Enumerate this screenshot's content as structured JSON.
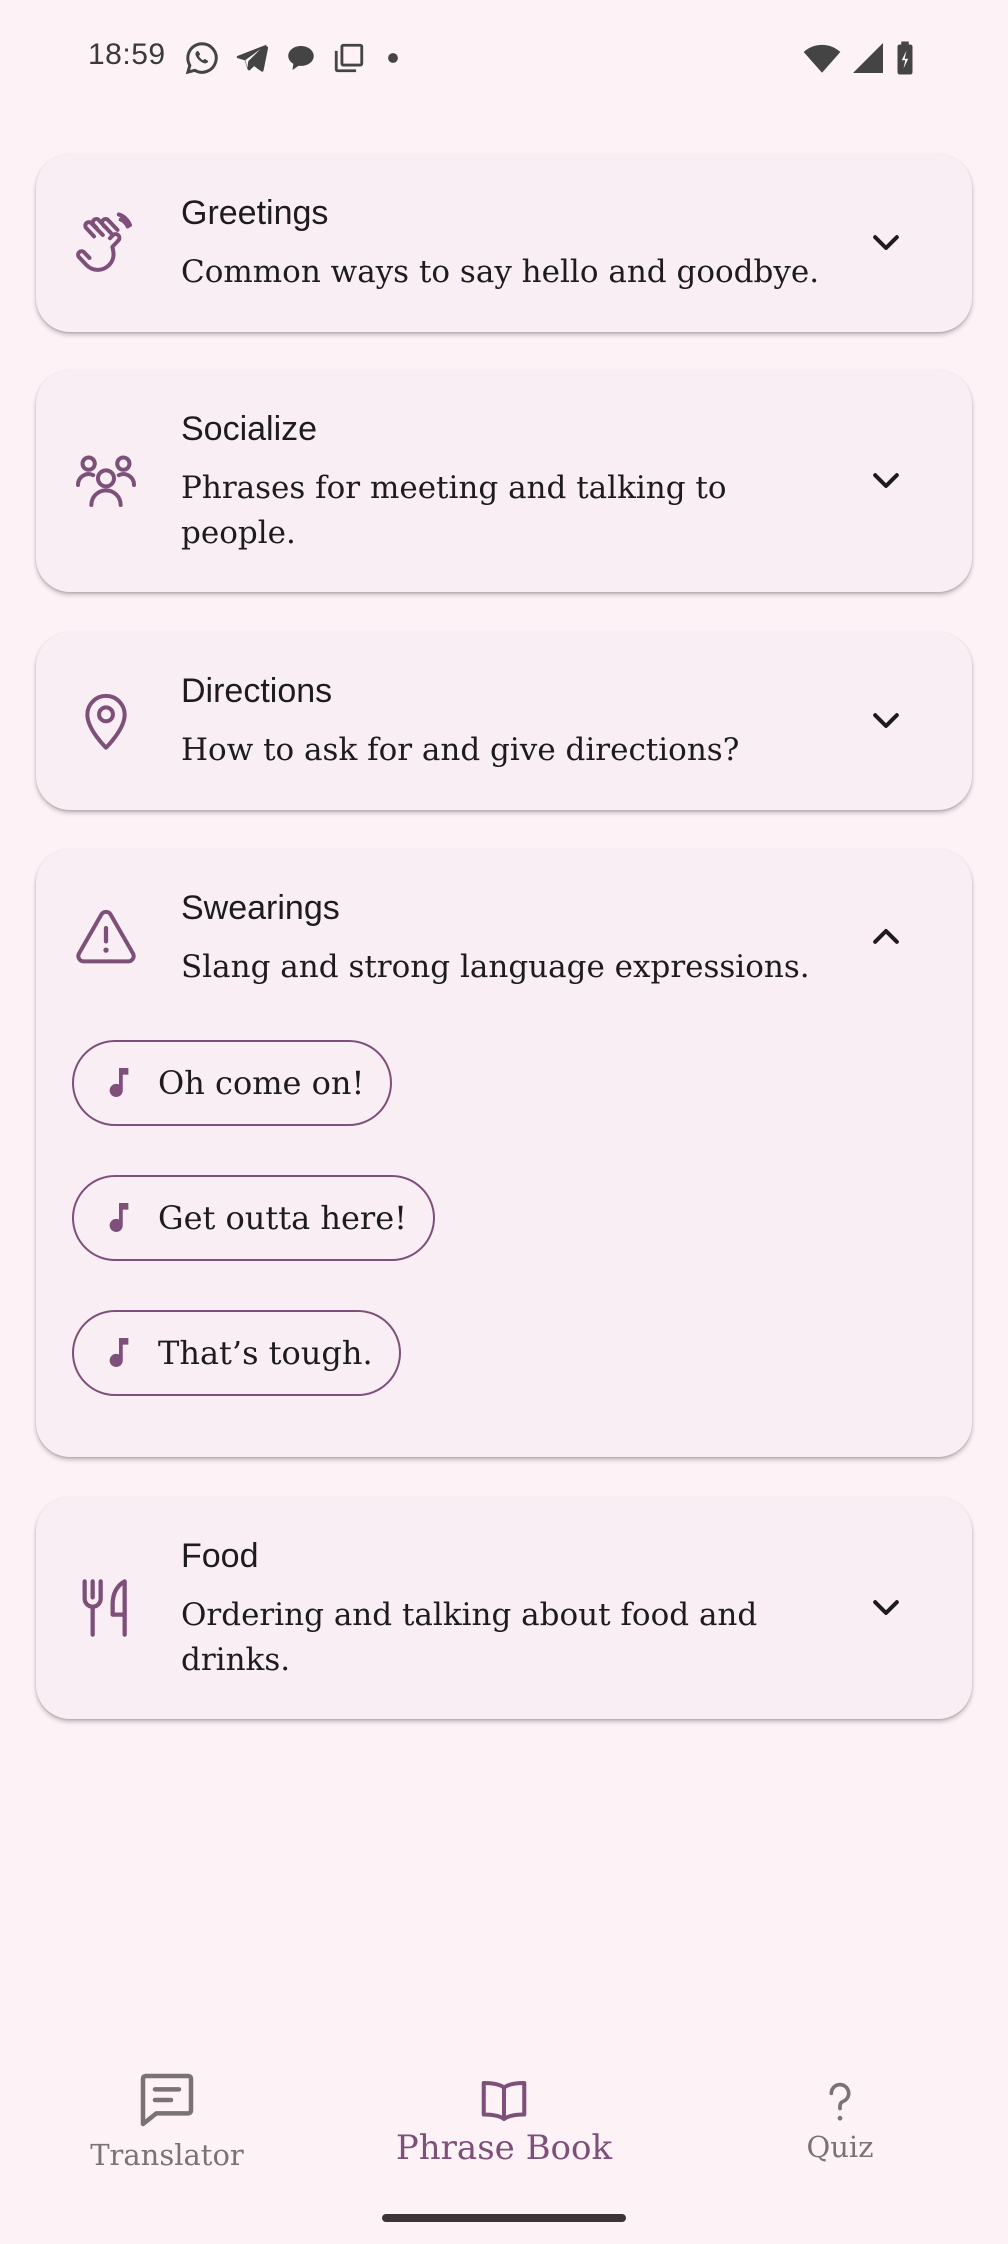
{
  "status_bar": {
    "time": "18:59",
    "left_icons": [
      "whatsapp-icon",
      "telegram-icon",
      "chat-bubble-icon",
      "copy-icon",
      "dot-icon"
    ],
    "right_icons": [
      "wifi-icon",
      "signal-icon",
      "battery-charging-icon"
    ]
  },
  "categories": [
    {
      "title": "Greetings",
      "description": "Common ways to say hello and goodbye.",
      "icon": "waving-hand-icon",
      "expanded": false
    },
    {
      "title": "Socialize",
      "description": "Phrases for meeting and talking to people.",
      "icon": "people-icon",
      "expanded": false
    },
    {
      "title": "Directions",
      "description": "How to ask for and give directions?",
      "icon": "location-pin-icon",
      "expanded": false
    },
    {
      "title": "Swearings",
      "description": "Slang and strong language expressions.",
      "icon": "warning-icon",
      "expanded": true,
      "phrases": [
        "Oh come on!",
        "Get outta here!",
        "That’s tough."
      ]
    },
    {
      "title": "Food",
      "description": "Ordering and talking about food and drinks.",
      "icon": "fork-knife-icon",
      "expanded": false
    }
  ],
  "bottom_nav": {
    "items": [
      {
        "label": "Translator",
        "icon": "message-icon",
        "active": false
      },
      {
        "label": "Phrase Book",
        "icon": "book-icon",
        "active": true
      },
      {
        "label": "Quiz",
        "icon": "question-icon",
        "active": false
      }
    ]
  },
  "colors": {
    "background": "#fdf3f7",
    "card": "#f8eef4",
    "accent": "#7d4f79",
    "text": "#1d1b1e",
    "inactive_nav": "#7a7376"
  }
}
